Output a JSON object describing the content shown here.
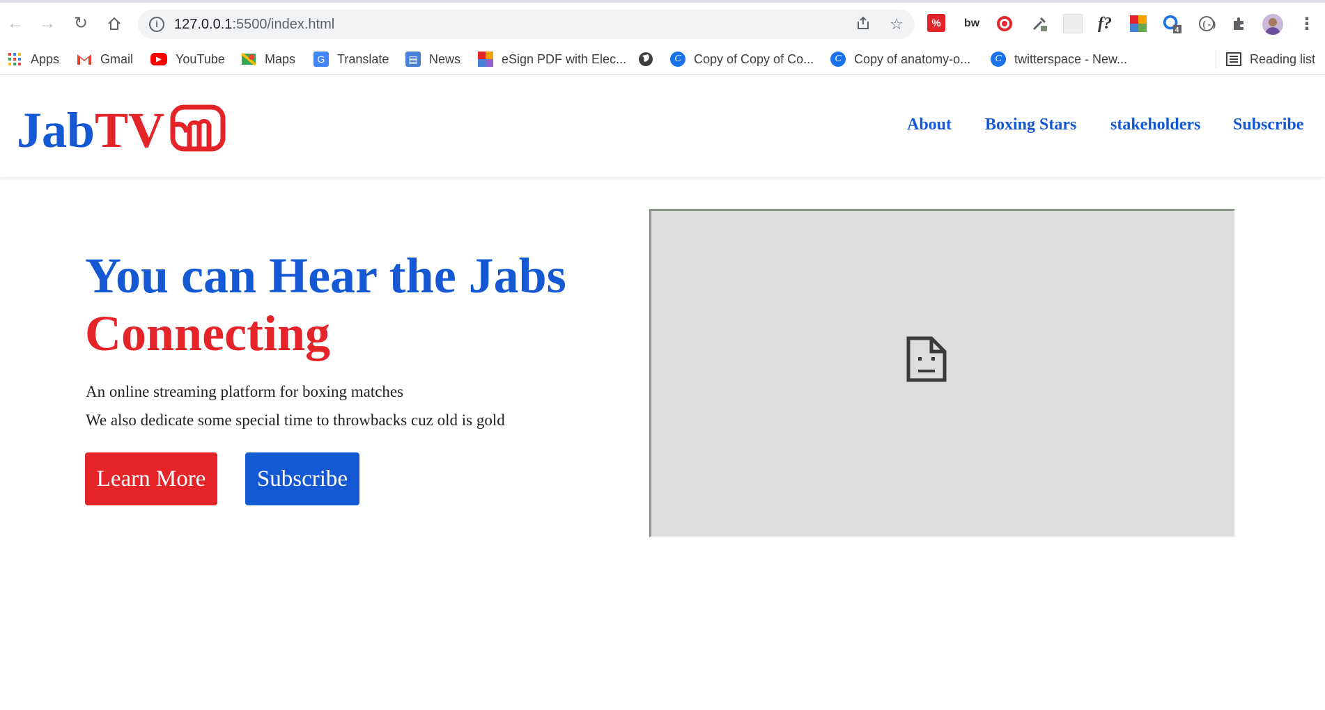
{
  "browser": {
    "url_host": "127.0.0.1",
    "url_path": ":5500/index.html",
    "bookmarks": [
      {
        "label": "Apps",
        "icon": "apps-grid-icon"
      },
      {
        "label": "Gmail",
        "icon": "gmail-icon"
      },
      {
        "label": "YouTube",
        "icon": "youtube-icon"
      },
      {
        "label": "Maps",
        "icon": "maps-icon"
      },
      {
        "label": "Translate",
        "icon": "translate-icon"
      },
      {
        "label": "News",
        "icon": "news-icon"
      },
      {
        "label": "eSign PDF with Elec...",
        "icon": "esign-icon"
      },
      {
        "label": "",
        "icon": "globe-icon"
      },
      {
        "label": "Copy of Copy of Co...",
        "icon": "c-circle-icon"
      },
      {
        "label": "Copy of anatomy-o...",
        "icon": "c-circle-icon"
      },
      {
        "label": "twitterspace - New...",
        "icon": "c-circle-icon"
      }
    ],
    "reading_list": "Reading list",
    "extension_badge": "4"
  },
  "site": {
    "logo": {
      "part1": "Jab",
      "part2": "TV"
    },
    "nav": [
      "About",
      "Boxing Stars",
      "stakeholders",
      "Subscribe"
    ],
    "hero": {
      "title_line1": "You can Hear the Jabs",
      "title_line2": "Connecting",
      "text_line1": "An online streaming platform for boxing matches",
      "text_line2": "We also dedicate some special time to throwbacks cuz old is gold",
      "btn_primary": "Learn More",
      "btn_secondary": "Subscribe"
    }
  },
  "colors": {
    "brand_blue": "#1458d4",
    "brand_red": "#e5242a",
    "frame_gray": "#dddddd"
  }
}
